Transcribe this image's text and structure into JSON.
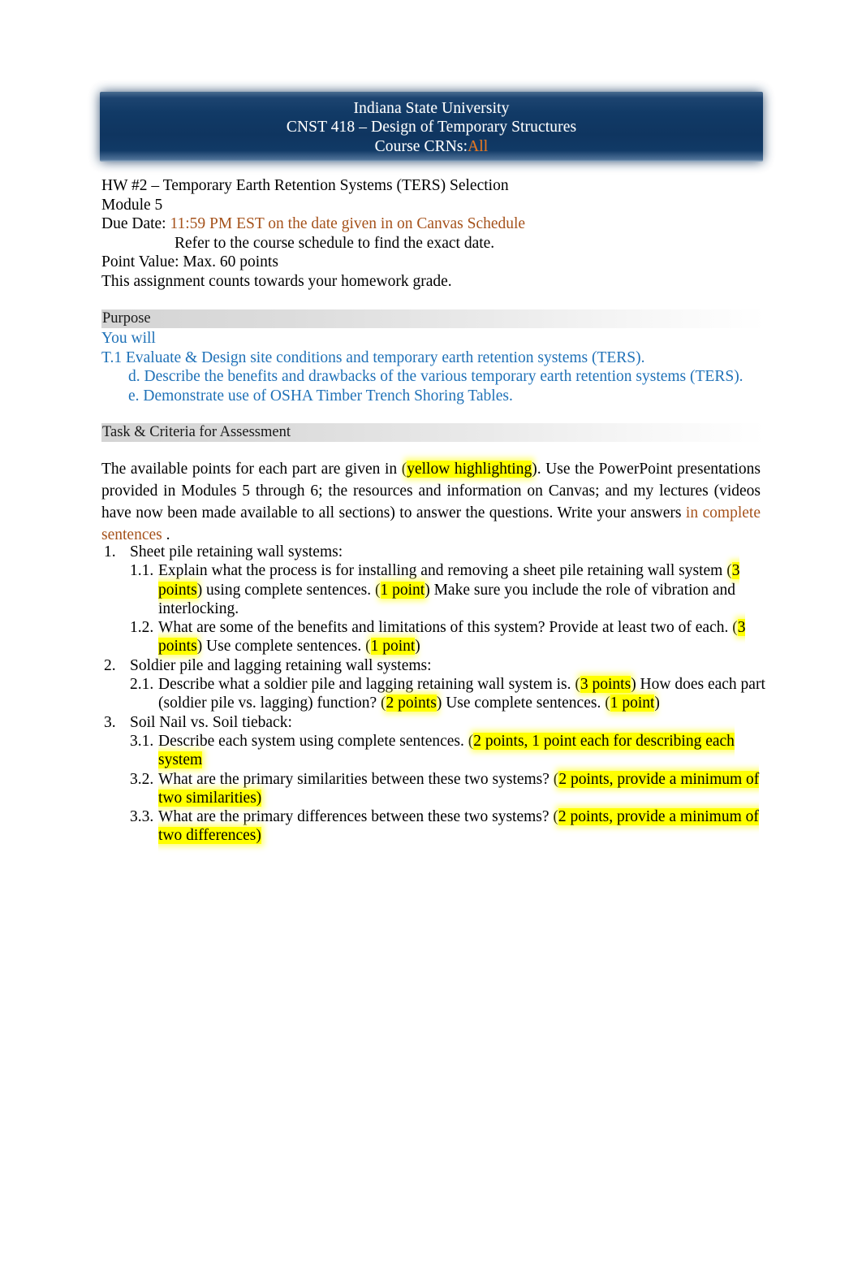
{
  "banner": {
    "line1": "Indiana State University",
    "line2": "CNST 418 – Design of Temporary Structures",
    "line3_label": "Course CRNs:",
    "line3_value": "All",
    "bg_color": "#113a66",
    "value_color": "#e8751a"
  },
  "meta": {
    "title": "HW #2 – Temporary Earth Retention Systems (TERS) Selection",
    "module": "Module 5",
    "due_label": "Due Date: ",
    "due_value": "11:59 PM EST on the date given in on Canvas Schedule",
    "due_note": "Refer to the course schedule to find the exact date.",
    "point_value": "Point Value: Max. 60 points",
    "grade_note": "This assignment counts towards your homework grade.",
    "accent_color": "#a5521b"
  },
  "purpose": {
    "heading": "Purpose",
    "intro": "You will",
    "objective": "T.1 Evaluate & Design site conditions and temporary earth retention systems (TERS).",
    "sub_items": [
      "d. Describe the benefits and drawbacks of the various temporary earth retention systems (TERS).",
      "e. Demonstrate use of OSHA Timber Trench Shoring Tables.",
      ""
    ],
    "text_color": "#2072b8"
  },
  "task": {
    "heading": "Task & Criteria for Assessment",
    "p1_a": "The available points for each part are given in (",
    "p1_hl": "yellow highlighting",
    "p1_b": "). Use the PowerPoint presentations provided in Modules 5 through 6; the resources and information on Canvas; and my lectures (videos have now been made available to all sections) to answer the questions. Write your answers ",
    "p1_tail": "in complete sentences",
    "p1_end": " ."
  },
  "questions": [
    {
      "num": "1.",
      "text": "Sheet pile retaining wall systems:",
      "subs": [
        {
          "num": "1.1.",
          "parts": [
            {
              "t": "Explain what the process is for installing and removing a sheet pile retaining wall system (",
              "hl": false
            },
            {
              "t": "3 points",
              "hl": true
            },
            {
              "t": ") using complete sentences. (",
              "hl": false
            },
            {
              "t": "1 point",
              "hl": true
            },
            {
              "t": ") Make sure you include the role of vibration and interlocking.",
              "hl": false
            }
          ]
        },
        {
          "num": "1.2.",
          "parts": [
            {
              "t": "What are some of the benefits and limitations of this system? Provide at least two of each. (",
              "hl": false
            },
            {
              "t": "3 points",
              "hl": true
            },
            {
              "t": ") Use complete sentences. (",
              "hl": false
            },
            {
              "t": "1 point",
              "hl": true
            },
            {
              "t": ")",
              "hl": false
            }
          ]
        }
      ]
    },
    {
      "num": "2.",
      "text": "Soldier pile and lagging retaining wall systems:",
      "subs": [
        {
          "num": "2.1.",
          "parts": [
            {
              "t": "Describe what a soldier pile and lagging retaining wall system is. (",
              "hl": false
            },
            {
              "t": "3 points",
              "hl": true
            },
            {
              "t": ") How does each part (soldier pile vs. lagging) function? (",
              "hl": false
            },
            {
              "t": "2 points",
              "hl": true
            },
            {
              "t": ") Use complete sentences. (",
              "hl": false
            },
            {
              "t": "1 point",
              "hl": true
            },
            {
              "t": ")",
              "hl": false
            }
          ]
        }
      ]
    },
    {
      "num": "3.",
      "text": "Soil Nail vs. Soil tieback:",
      "subs": [
        {
          "num": "3.1.",
          "parts": [
            {
              "t": "Describe each system using complete sentences. (",
              "hl": false
            },
            {
              "t": "2 points, 1 point each for describing each system",
              "hl": true
            }
          ]
        },
        {
          "num": "3.2.",
          "parts": [
            {
              "t": "What are the primary similarities between these two systems? (",
              "hl": false
            },
            {
              "t": "2 points, provide a minimum of two similarities)",
              "hl": true
            }
          ]
        },
        {
          "num": "3.3.",
          "parts": [
            {
              "t": "What are the primary differences between these two systems? (",
              "hl": false
            },
            {
              "t": "2 points, provide a minimum of two differences)",
              "hl": true
            }
          ]
        }
      ]
    }
  ]
}
